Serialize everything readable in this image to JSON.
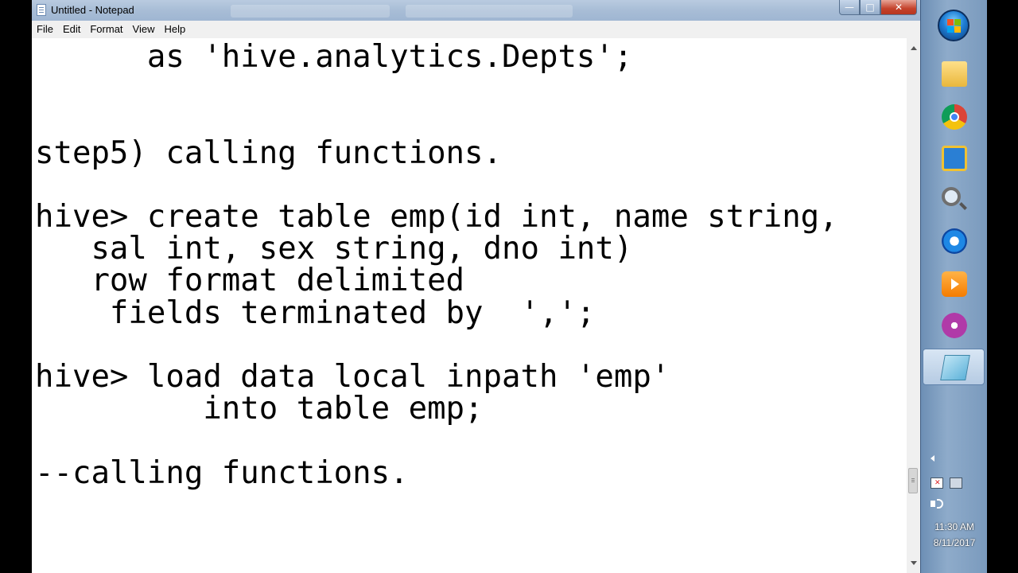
{
  "window": {
    "title": "Untitled - Notepad",
    "controls": {
      "minimize": "—",
      "maximize": "□",
      "close": "✕"
    }
  },
  "menu": {
    "items": [
      {
        "label": "File"
      },
      {
        "label": "Edit"
      },
      {
        "label": "Format"
      },
      {
        "label": "View"
      },
      {
        "label": "Help"
      }
    ]
  },
  "editor": {
    "content": "      as 'hive.analytics.Depts';\n\n\nstep5) calling functions.\n\nhive> create table emp(id int, name string,\n   sal int, sex string, dno int)\n   row format delimited\n    fields terminated by  ',';\n\nhive> load data local inpath 'emp'\n         into table emp;\n\n--calling functions."
  },
  "taskbar": {
    "start_icon": "windows-start-orb",
    "apps": [
      {
        "icon": "folder-icon"
      },
      {
        "icon": "chrome-icon"
      },
      {
        "icon": "virtualbox-icon"
      },
      {
        "icon": "search-icon"
      },
      {
        "icon": "internet-explorer-icon"
      },
      {
        "icon": "media-player-icon"
      },
      {
        "icon": "flower-app-icon"
      },
      {
        "icon": "notepad-icon",
        "active": true
      }
    ],
    "tray": {
      "time": "11:30 AM",
      "date": "8/11/2017"
    }
  },
  "colors": {
    "titlebar": "#a8bdd6",
    "close_button": "#c4422b",
    "taskbar": "#7a9abd",
    "editor_background": "#ffffff",
    "text": "#000000"
  }
}
